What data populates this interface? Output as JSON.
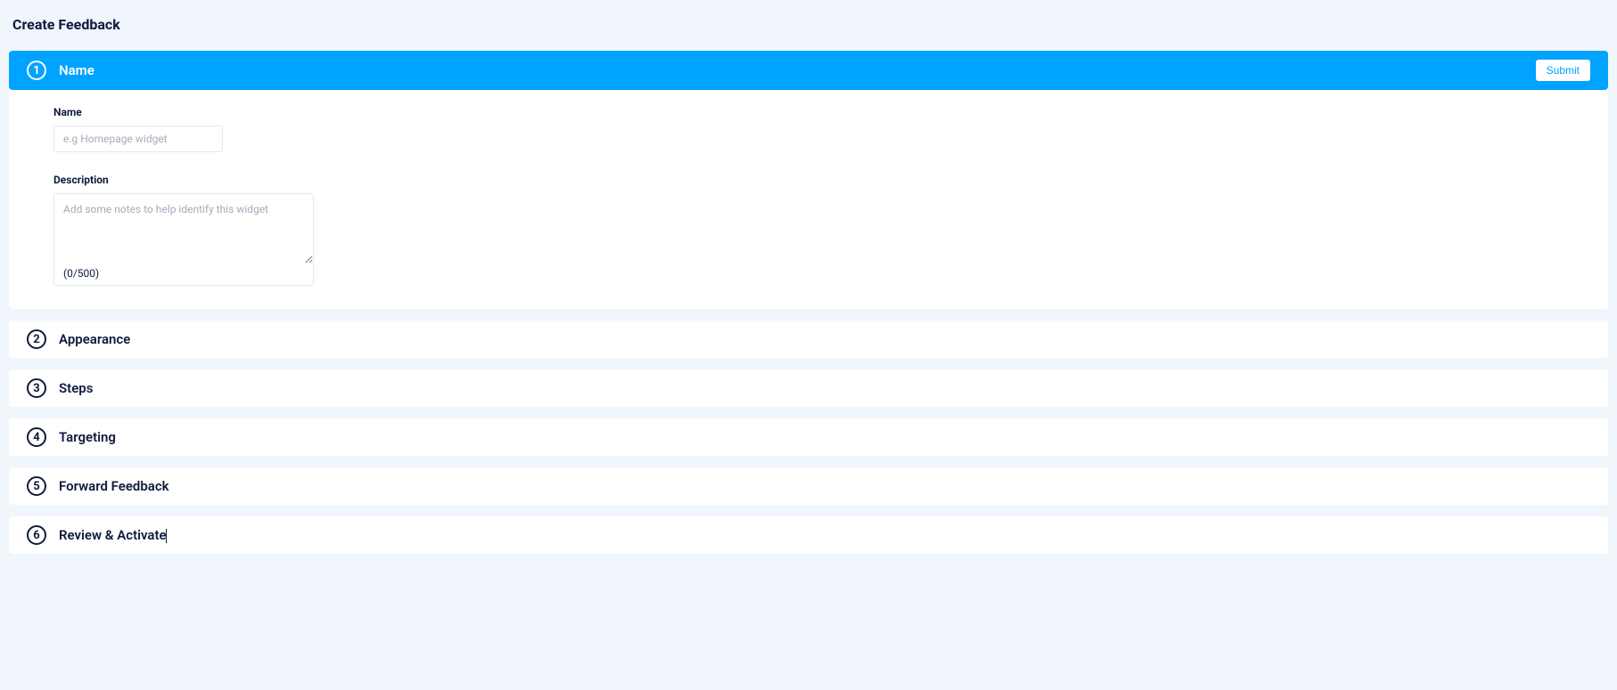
{
  "page_title": "Create Feedback",
  "steps": [
    {
      "number": "1",
      "title": "Name",
      "active": true,
      "submit_label": "Submit",
      "fields": {
        "name_label": "Name",
        "name_placeholder": "e.g Homepage widget",
        "name_value": "",
        "description_label": "Description",
        "description_placeholder": "Add some notes to help identify this widget",
        "description_value": "",
        "char_counter": "(0/500)"
      }
    },
    {
      "number": "2",
      "title": "Appearance",
      "active": false
    },
    {
      "number": "3",
      "title": "Steps",
      "active": false
    },
    {
      "number": "4",
      "title": "Targeting",
      "active": false
    },
    {
      "number": "5",
      "title": "Forward Feedback",
      "active": false
    },
    {
      "number": "6",
      "title": "Review & Activate",
      "active": false
    }
  ]
}
